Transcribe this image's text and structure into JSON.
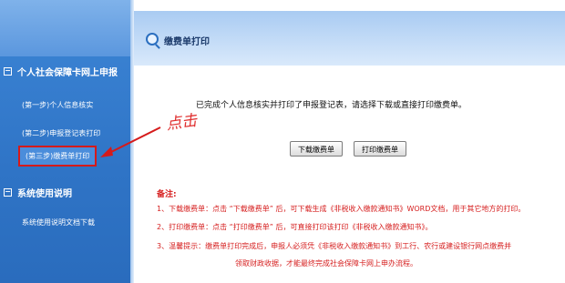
{
  "sidebar": {
    "section1": {
      "toggle": "−",
      "label": "个人社会保障卡网上申报"
    },
    "items": [
      {
        "label": "(第一步)个人信息核实"
      },
      {
        "label": "(第二步)申报登记表打印"
      },
      {
        "label": "(第三步)缴费单打印"
      }
    ],
    "section2": {
      "toggle": "−",
      "label": "系统使用说明"
    },
    "section2_items": [
      {
        "label": "系统使用说明文档下载"
      }
    ]
  },
  "main": {
    "header_title": "缴费单打印",
    "notice": "已完成个人信息核实并打印了申报登记表，请选择下载或直接打印缴费单。",
    "annotation": "点击",
    "buttons": {
      "download": "下载缴费单",
      "print": "打印缴费单"
    },
    "notes_title": "备注:",
    "notes": [
      "1、下载缴费单：点击 “下载缴费单” 后，可下载生成《非税收入缴款通知书》WORD文档，用于其它地方的打印。",
      "2、打印缴费单：点击 “打印缴费单” 后，可直接打印该打印《非税收入缴款通知书》。",
      "3、温馨提示：缴费单打印完成后，申报人必须凭《非税收入缴款通知书》到工行、农行或建设银行网点缴费并",
      "领取财政收据，才能最终完成社会保障卡网上申办流程。"
    ]
  },
  "colors": {
    "sidebar_bg": "#2f74c6",
    "annotation_red": "#d51a1a",
    "notes_red": "#d62020"
  }
}
